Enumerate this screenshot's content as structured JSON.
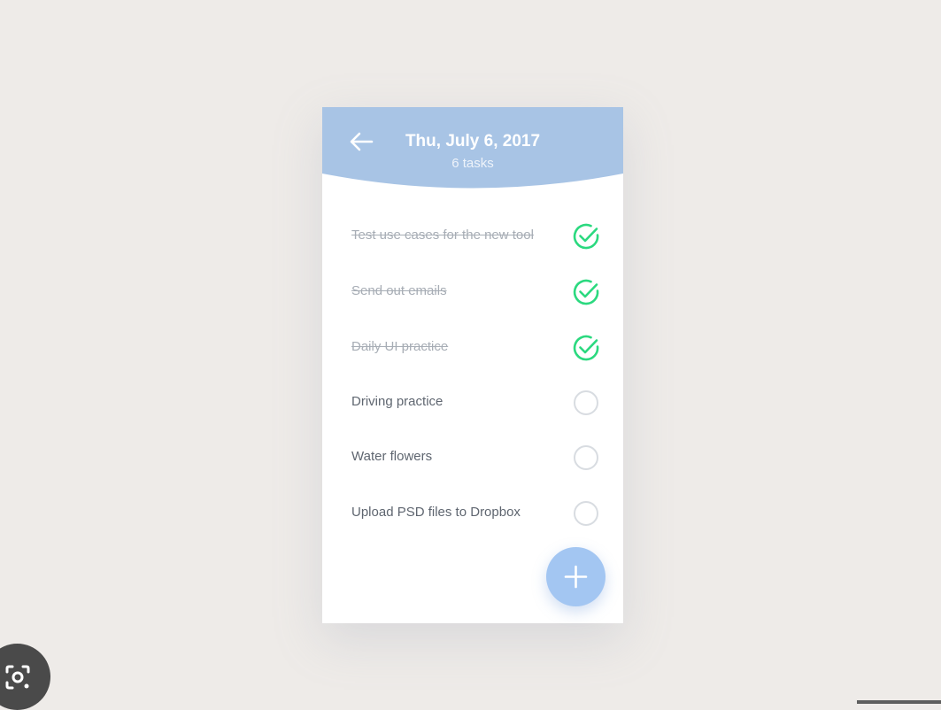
{
  "header": {
    "date": "Thu, July 6, 2017",
    "task_count": "6 tasks",
    "back_icon": "arrow-left-icon",
    "color": "#a8c4e5"
  },
  "tasks": [
    {
      "label": "Test use cases for the new tool",
      "done": true
    },
    {
      "label": "Send out emails",
      "done": true
    },
    {
      "label": "Daily UI practice",
      "done": true
    },
    {
      "label": "Driving practice",
      "done": false
    },
    {
      "label": "Water flowers",
      "done": false
    },
    {
      "label": "Upload PSD files to Dropbox",
      "done": false
    }
  ],
  "fab": {
    "icon": "plus-icon",
    "color": "#a3c6f2"
  },
  "colors": {
    "check_done": "#2bd97f",
    "check_empty": "#d8dce1",
    "background": "#eeebe8"
  },
  "overlay": {
    "lens_icon": "camera-lens-icon"
  }
}
